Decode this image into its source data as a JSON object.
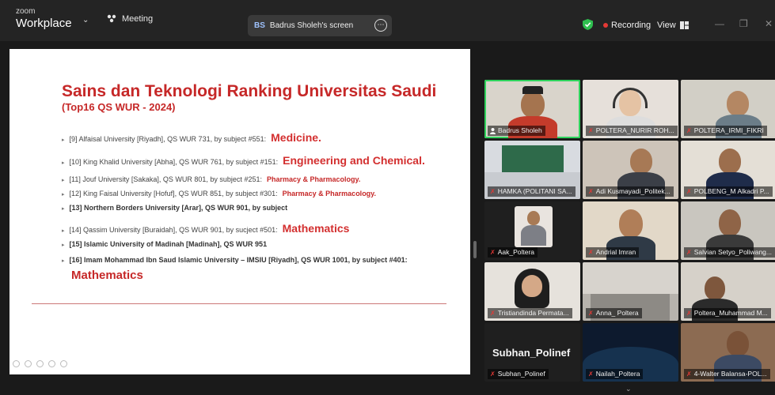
{
  "titlebar": {
    "app_small": "zoom",
    "app_name": "Workplace",
    "meeting_label": "Meeting",
    "screen_initials": "BS",
    "screen_label": "Badrus Sholeh's screen",
    "recording_label": "Recording",
    "view_label": "View"
  },
  "slide": {
    "title": "Sains dan Teknologi Ranking Universitas Saudi",
    "subtitle": "(Top16 QS WUR - 2024)",
    "items": [
      {
        "text": "[9] Alfaisal University [Riyadh], QS WUR 731, by subject #551:",
        "subject": "Medicine."
      },
      {
        "text": "[10] King Khalid University [Abha], QS WUR 761, by subject #151:",
        "subject": "Engineering and Chemical."
      },
      {
        "text": "[11] Jouf University [Sakaka], QS WUR 801, by subject #251:",
        "subject": "Pharmacy & Pharmacology."
      },
      {
        "text": "[12]  King Faisal University [Hofuf], QS WUR 851, by subject #301:",
        "subject": "Pharmacy & Pharmacology."
      },
      {
        "text": "[13] Northern Borders University [Arar], QS WUR 901, by subject",
        "subject": ""
      },
      {
        "text": "[14] Qassim University [Buraidah], QS WUR 901, by sucject #501:",
        "subject": "Mathematics"
      },
      {
        "text": "[15] Islamic University of Madinah [Madinah], QS WUR 951",
        "subject": ""
      },
      {
        "text": "[16] Imam Mohammad Ibn Saud Islamic University – IMSIU [Riyadh], QS WUR 1001, by subject #401:",
        "subject": ""
      }
    ],
    "continuation": "Mathematics"
  },
  "gallery": {
    "participants": [
      {
        "name": "Badrus Sholeh"
      },
      {
        "name": "POLTERA_NURIR ROH..."
      },
      {
        "name": "POLTERA_IRMI_FIKRI"
      },
      {
        "name": "HAMKA (POLITANI SA..."
      },
      {
        "name": "Adi Kusmayadi_Politek..."
      },
      {
        "name": "POLBENG_M Alkadri P..."
      },
      {
        "name": "Aak_Poltera"
      },
      {
        "name": "Andrial Imran"
      },
      {
        "name": "Salvian Setyo_Poliwang..."
      },
      {
        "name": "Tristiandinda Permata..."
      },
      {
        "name": "Anna_ Poltera"
      },
      {
        "name": "Poltera_Muhammad M..."
      },
      {
        "name": "Subhan_Polinef",
        "display": "Subhan_Polinef"
      },
      {
        "name": "Nailah_Poltera"
      },
      {
        "name": "4-Walter Balansa-POL..."
      }
    ]
  },
  "colors": {
    "accent_red": "#c62828",
    "active_speaker": "#2fd35d",
    "recording_dot": "#e53935"
  }
}
